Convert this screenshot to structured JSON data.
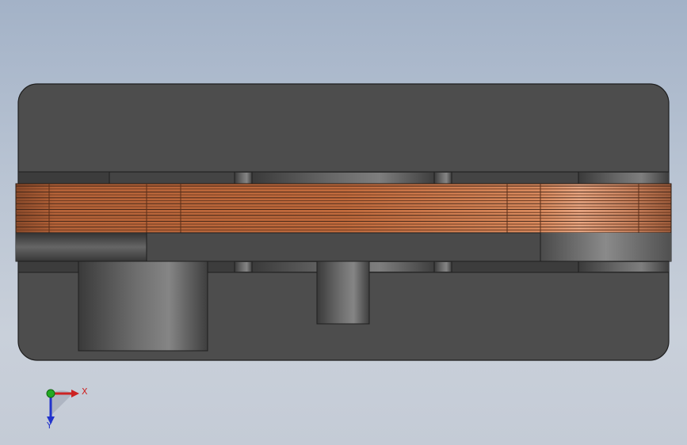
{
  "viewport": {
    "background_top": "#a3b2c7",
    "background_bottom": "#c4cbd6"
  },
  "model": {
    "body_color": "#4d4d4d",
    "edge_color": "#1e1e1e",
    "coil_color": "#c06a3c",
    "coil_highlight": "#e6a07a",
    "cylinder_color": "#5a5a5a"
  },
  "triad": {
    "x_label": "X",
    "y_label": "Y",
    "x_color": "#cc2222",
    "y_color": "#2233cc",
    "origin_color": "#22aa22",
    "icon": "coordinate-triad-icon"
  }
}
